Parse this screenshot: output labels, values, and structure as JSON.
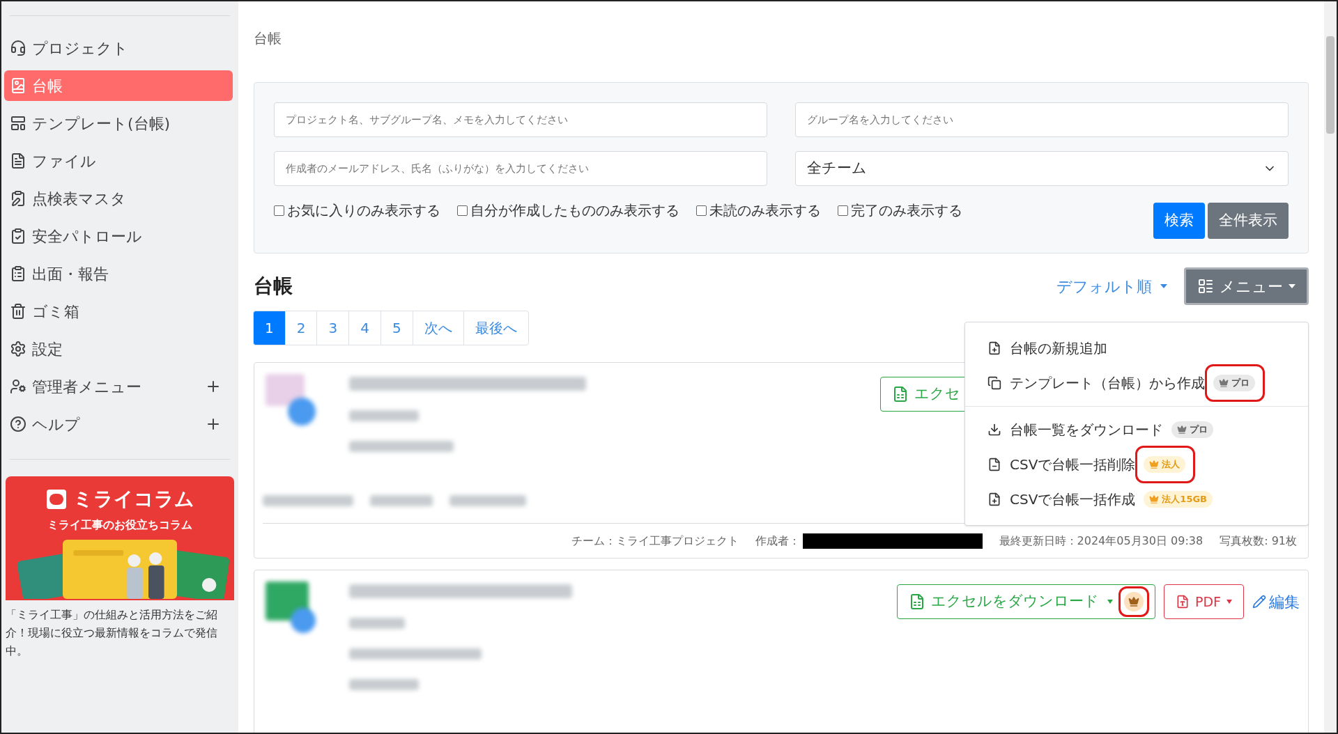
{
  "breadcrumb": "台帳",
  "sidebar": {
    "items": [
      {
        "label": "プロジェクト",
        "selected": false,
        "expandable": false
      },
      {
        "label": "台帳",
        "selected": true,
        "expandable": false
      },
      {
        "label": "テンプレート(台帳)",
        "selected": false,
        "expandable": false
      },
      {
        "label": "ファイル",
        "selected": false,
        "expandable": false
      },
      {
        "label": "点検表マスタ",
        "selected": false,
        "expandable": false
      },
      {
        "label": "安全パトロール",
        "selected": false,
        "expandable": false
      },
      {
        "label": "出面・報告",
        "selected": false,
        "expandable": false
      },
      {
        "label": "ゴミ箱",
        "selected": false,
        "expandable": false
      },
      {
        "label": "設定",
        "selected": false,
        "expandable": false
      },
      {
        "label": "管理者メニュー",
        "selected": false,
        "expandable": true
      },
      {
        "label": "ヘルプ",
        "selected": false,
        "expandable": true
      }
    ]
  },
  "banner": {
    "title": "ミライコラム",
    "subtitle": "ミライ工事のお役立ちコラム",
    "description": "「ミライ工事」の仕組みと活用方法をご紹介！現場に役立つ最新情報をコラムで発信中。"
  },
  "filters": {
    "fields": [
      {
        "placeholder": "プロジェクト名、サブグループ名、メモを入力してください"
      },
      {
        "placeholder": "グループ名を入力してください"
      },
      {
        "placeholder": "作成者のメールアドレス、氏名（ふりがな）を入力してください"
      }
    ],
    "team_select": {
      "value": "全チーム"
    },
    "checkboxes": [
      {
        "label": "お気に入りのみ表示する",
        "checked": false
      },
      {
        "label": "自分が作成したもののみ表示する",
        "checked": false
      },
      {
        "label": "未読のみ表示する",
        "checked": false
      },
      {
        "label": "完了のみ表示する",
        "checked": false
      }
    ],
    "buttons": [
      {
        "label": "検索",
        "kind": "primary"
      },
      {
        "label": "全件表示",
        "kind": "secondary"
      }
    ]
  },
  "list": {
    "title": "台帳",
    "sort": "デフォルト順",
    "menu_button": "メニュー",
    "pagination": [
      {
        "label": "1",
        "selected": true
      },
      {
        "label": "2",
        "selected": false
      },
      {
        "label": "3",
        "selected": false
      },
      {
        "label": "4",
        "selected": false
      },
      {
        "label": "5",
        "selected": false
      },
      {
        "label": "次へ",
        "selected": false
      },
      {
        "label": "最後へ",
        "selected": false
      }
    ]
  },
  "menu": {
    "groups": [
      [
        {
          "label": "台帳の新規追加",
          "highlighted": false
        },
        {
          "label": "テンプレート（台帳）から作成",
          "badge": {
            "text": "プロ",
            "kind": "pro"
          },
          "highlighted": true
        }
      ],
      [
        {
          "label": "台帳一覧をダウンロード",
          "badge": {
            "text": "プロ",
            "kind": "pro"
          },
          "highlighted": false
        },
        {
          "label": "CSVで台帳一括削除",
          "badge": {
            "text": "法人",
            "kind": "corporate"
          },
          "highlighted": true
        },
        {
          "label": "CSVで台帳一括作成",
          "badge": {
            "text": "法人15GB",
            "kind": "corporate"
          },
          "highlighted": false
        }
      ]
    ]
  },
  "cards": [
    {
      "excel_button": "エクセ",
      "footer": {
        "team": "チーム：ミライ工事プロジェクト",
        "author_label": "作成者：",
        "updated": "最終更新日時：2024年05月30日 09:38",
        "photos": "写真枚数: 91枚"
      }
    },
    {
      "excel_button": "エクセルをダウンロード",
      "crown_highlighted": true,
      "pdf_button": "PDF",
      "edit_link": "編集"
    }
  ]
}
